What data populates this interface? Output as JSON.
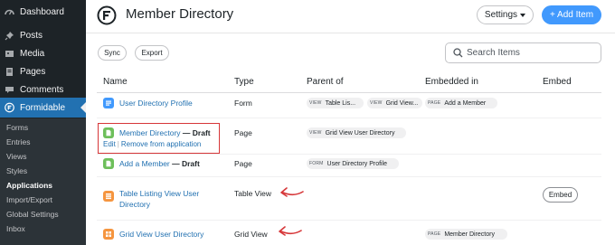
{
  "sidebar": {
    "menu": [
      {
        "label": "Dashboard",
        "icon": "dashboard-icon"
      },
      {
        "label": "Posts",
        "icon": "pin-icon"
      },
      {
        "label": "Media",
        "icon": "media-icon"
      },
      {
        "label": "Pages",
        "icon": "pages-icon"
      },
      {
        "label": "Comments",
        "icon": "comments-icon"
      },
      {
        "label": "Formidable",
        "icon": "formidable-icon"
      }
    ],
    "submenu": [
      "Forms",
      "Entries",
      "Views",
      "Styles",
      "Applications",
      "Import/Export",
      "Global Settings",
      "Inbox"
    ]
  },
  "header": {
    "title": "Member Directory",
    "settings_label": "Settings",
    "add_label": "+ Add Item"
  },
  "toolbar": {
    "sync_label": "Sync",
    "export_label": "Export",
    "search_placeholder": "Search Items"
  },
  "table": {
    "columns": [
      "Name",
      "Type",
      "Parent of",
      "Embedded in",
      "Embed"
    ],
    "rows": [
      {
        "name": "User Directory Profile",
        "draft": "",
        "type": "Form",
        "icon_color": "blue",
        "parent_of": [
          {
            "kind": "VIEW",
            "label": "Table Lis..."
          },
          {
            "kind": "VIEW",
            "label": "Grid View..."
          }
        ],
        "embedded_in": [
          {
            "kind": "PAGE",
            "label": "Add a Member"
          }
        ]
      },
      {
        "name": "Member Directory",
        "draft": " — Draft",
        "type": "Page",
        "icon_color": "green",
        "parent_of": [
          {
            "kind": "VIEW",
            "label": "Grid View User Directory"
          }
        ],
        "embedded_in": [],
        "actions": {
          "edit": "Edit",
          "separator": "|",
          "remove": "Remove from application"
        }
      },
      {
        "name": "Add a Member",
        "draft": " — Draft",
        "type": "Page",
        "icon_color": "green",
        "parent_of": [
          {
            "kind": "FORM",
            "label": "User Directory Profile"
          }
        ],
        "embedded_in": []
      },
      {
        "name_line1": "Table Listing View User",
        "name_line2": "Directory",
        "type": "Table View",
        "icon_color": "orange",
        "parent_of": [],
        "embedded_in": [],
        "embed_label": "Embed"
      },
      {
        "name": "Grid View User Directory",
        "type": "Grid View",
        "icon_color": "orange",
        "parent_of": [],
        "embedded_in": [
          {
            "kind": "PAGE",
            "label": "Member Directory"
          }
        ]
      }
    ]
  },
  "colors": {
    "sidebar_bg": "#1d2327",
    "active_blue": "#2271b1",
    "primary_button": "#4199fd",
    "highlight_red": "#d63638",
    "annotation_arrow": "#d63638"
  }
}
